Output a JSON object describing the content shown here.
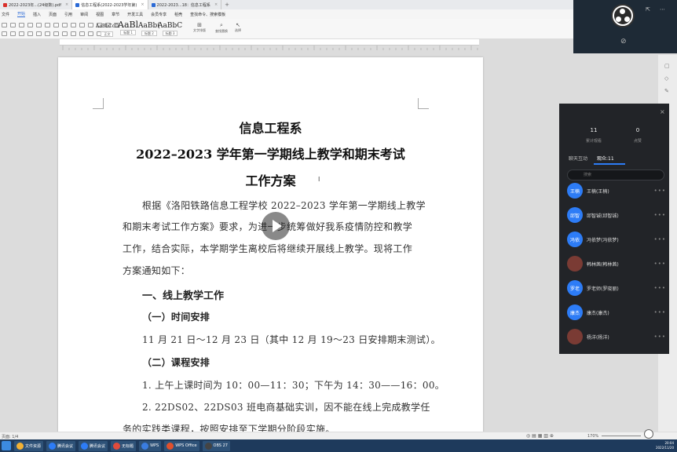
{
  "tabs": [
    {
      "label": "2022-2023年...(24级数).pdf",
      "color": "#d9302c",
      "active": false
    },
    {
      "label": "信息工程系(2022-2023学年第)",
      "color": "#2b6ad6",
      "active": true
    },
    {
      "label": "2022-2023...18：信息工程系",
      "color": "#2b6ad6",
      "active": false
    }
  ],
  "menu": [
    "文件",
    "开始",
    "插入",
    "页面",
    "引用",
    "审阅",
    "视图",
    "章节",
    "开发工具",
    "会员专享",
    "稻壳",
    "查找命令、搜索模板"
  ],
  "ribbon": {
    "styles": [
      {
        "sample": "AaBbCcD",
        "label": "正文"
      },
      {
        "sample": "AaBl",
        "label": "标题 1"
      },
      {
        "sample": "AaBb(",
        "label": "标题 2"
      },
      {
        "sample": "AaBbC",
        "label": "标题 3"
      }
    ],
    "text_tools": "文字排版",
    "find_replace": "查找替换",
    "select": "选择"
  },
  "document": {
    "title1": "信息工程系",
    "title2": "2022–2023 学年第一学期线上教学和期末考试",
    "title3": "工作方案",
    "para1": [
      "根据《洛阳铁路信息工程学校 2022–2023 学年第一学期线上教学",
      "和期末考试工作方案》要求，为进一步统筹做好我系疫情防控和教学",
      "工作，结合实际，本学期学生离校后将继续开展线上教学。现将工作",
      "方案通知如下："
    ],
    "h1": "一、线上教学工作",
    "h1a": "（一）时间安排",
    "time_text": "11 月 21 日～12 月 23 日（其中 12 月 19～23 日安排期末测试）。",
    "h1b": "（二）课程安排",
    "course1": "1. 上午上课时间为 10：00—11：30；下午为 14：30——16：00。",
    "course2a": "2. 22DS02、22DS03 班电商基础实训，因不能在线上完成教学任",
    "course2b": "务的实践类课程，按照安排至下学期分阶段实施。"
  },
  "meeting": {
    "stats": [
      {
        "value": "11",
        "label": "累计观看"
      },
      {
        "value": "0",
        "label": "点赞"
      }
    ],
    "tabs": [
      {
        "label": "聊天互动",
        "selected": false
      },
      {
        "label": "观众:11",
        "selected": true
      }
    ],
    "search_placeholder": "搜索",
    "members": [
      {
        "avatar": "王楠",
        "name": "王楠(王楠)",
        "photo": false
      },
      {
        "avatar": "邱智",
        "name": "邱智铖(邱智铖)",
        "photo": false
      },
      {
        "avatar": "冯依",
        "name": "冯依梦(冯依梦)",
        "photo": false
      },
      {
        "avatar": "",
        "name": "韩林茜(韩林茜)",
        "photo": true
      },
      {
        "avatar": "罗老",
        "name": "罗老师(罗晓丽)",
        "photo": false
      },
      {
        "avatar": "康杰",
        "name": "康杰(康杰)",
        "photo": false
      },
      {
        "avatar": "",
        "name": "杨洋(杨洋)",
        "photo": true
      }
    ]
  },
  "statusbar": {
    "left": "页面: 1/4",
    "zoom": "170%"
  },
  "taskbar": {
    "items": [
      {
        "label": "文件资源",
        "color": "#f2b134"
      },
      {
        "label": "腾讯会议",
        "color": "#2d7cf6"
      },
      {
        "label": "腾讯会议",
        "color": "#2d7cf6"
      },
      {
        "label": "无标题",
        "color": "#e04b3c"
      },
      {
        "label": "WPS",
        "color": "#3a7de0"
      },
      {
        "label": "WPS Office",
        "color": "#e0502c"
      },
      {
        "label": "OBS 27",
        "color": "#444444"
      }
    ],
    "time": "2022/11/20",
    "clock": "20:04"
  },
  "colors": {
    "accent": "#2d7cf6",
    "panel_bg": "#222428",
    "taskbar_bg": "#1e3a5c"
  }
}
